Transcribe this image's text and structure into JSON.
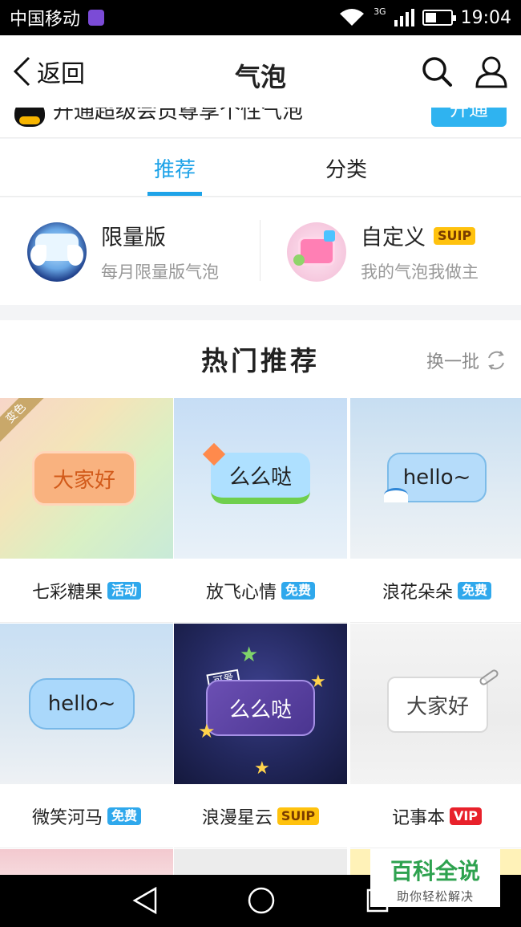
{
  "status_bar": {
    "carrier": "中国移动",
    "network": "3G",
    "time": "19:04"
  },
  "header": {
    "back_label": "返回",
    "title": "气泡"
  },
  "banner": {
    "text": "开通超级会员尊享个性气泡",
    "button": "开通"
  },
  "tabs": [
    {
      "label": "推荐"
    },
    {
      "label": "分类"
    }
  ],
  "features": [
    {
      "name": "限量版",
      "sub": "每月限量版气泡"
    },
    {
      "name": "自定义",
      "badge": "SUIP",
      "sub": "我的气泡我做主"
    }
  ],
  "hot": {
    "title": "热门推荐",
    "refresh": "换一批"
  },
  "items": [
    {
      "name": "七彩糖果",
      "badge": "活动",
      "bubble": "大家好",
      "corner": "变色"
    },
    {
      "name": "放飞心情",
      "badge": "免费",
      "bubble": "么么哒"
    },
    {
      "name": "浪花朵朵",
      "badge": "免费",
      "bubble": "hello~"
    },
    {
      "name": "微笑河马",
      "badge": "免费",
      "bubble": "hello~"
    },
    {
      "name": "浪漫星云",
      "badge": "SUIP",
      "bubble": "么么哒",
      "tag": "可爱"
    },
    {
      "name": "记事本",
      "badge": "VIP",
      "bubble": "大家好"
    }
  ],
  "watermark": {
    "line1": "百科全说",
    "line2": "助你轻松解决"
  },
  "colors": {
    "accent": "#1ea3e8",
    "suip": "#ffc20e",
    "vip": "#e8212b"
  }
}
